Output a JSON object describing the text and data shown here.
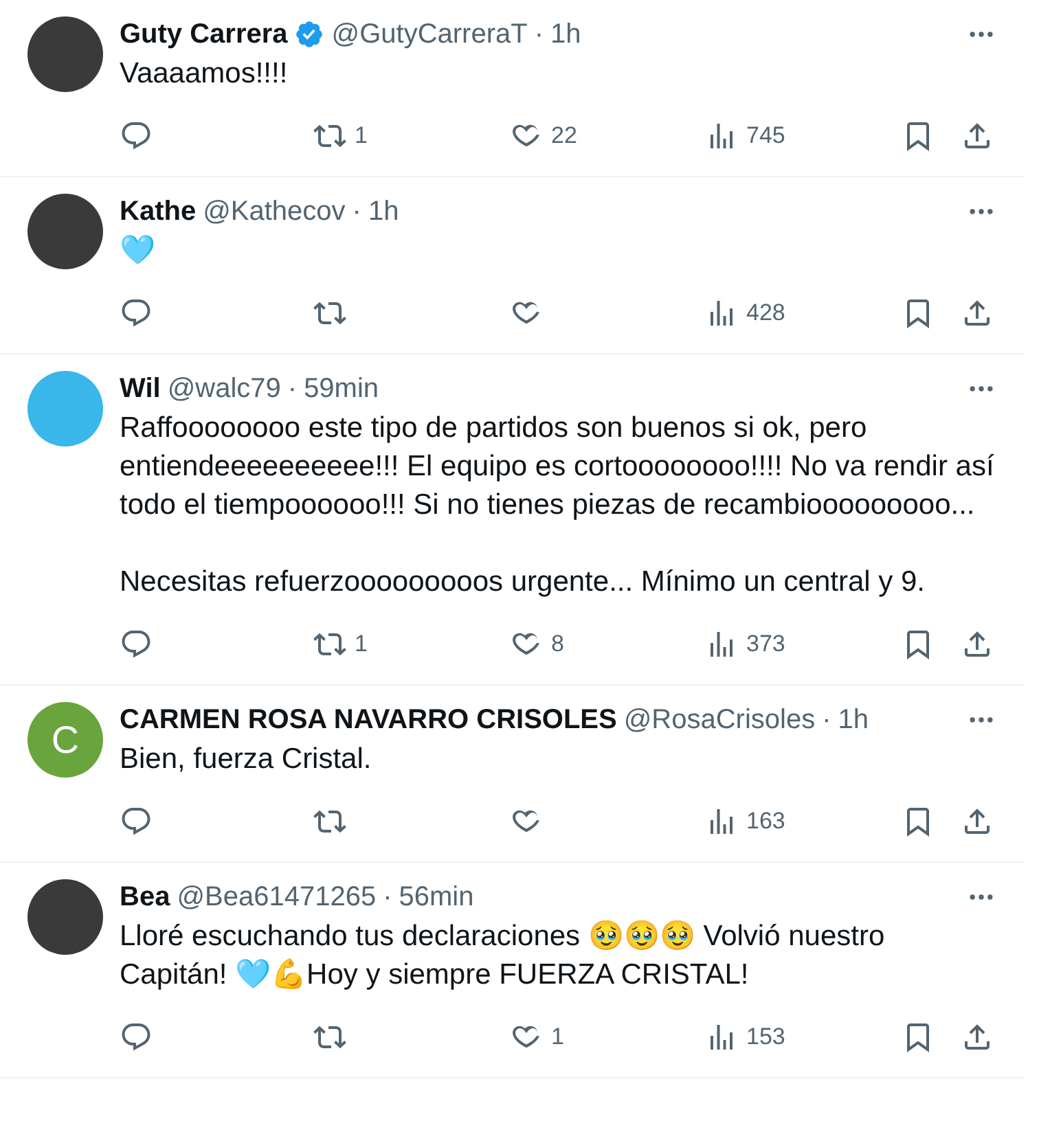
{
  "tweets": [
    {
      "avatar": {
        "kind": "photo"
      },
      "name": "Guty Carrera",
      "verified": true,
      "handle": "@GutyCarreraT",
      "separator": "·",
      "time": "1h",
      "text": [
        "Vaaaamos!!!!"
      ],
      "stats": {
        "retweets": "1",
        "likes": "22",
        "views": "745"
      }
    },
    {
      "avatar": {
        "kind": "photo"
      },
      "name": "Kathe",
      "verified": false,
      "handle": "@Kathecov",
      "separator": "·",
      "time": "1h",
      "text": [
        "🩵"
      ],
      "stats": {
        "views": "428"
      }
    },
    {
      "avatar": {
        "kind": "logo"
      },
      "name": "Wil",
      "verified": false,
      "handle": "@walc79",
      "separator": "·",
      "time": "59min",
      "text": [
        "Raffoooooooo este tipo de partidos son buenos si ok, pero entiendeeeeeeeeee!!! El equipo es cortoooooooo!!!! No va rendir así todo el tiempoooooo!!! Si no tienes piezas de recambiooooooooo...",
        "Necesitas refuerzooooooooos urgente... Mínimo un central y 9."
      ],
      "stats": {
        "retweets": "1",
        "likes": "8",
        "views": "373"
      }
    },
    {
      "avatar": {
        "kind": "letter",
        "letter": "C",
        "color": "#6aa43c"
      },
      "name": "CARMEN ROSA NAVARRO CRISOLES",
      "verified": false,
      "handle": "@RosaCrisoles",
      "separator": "·",
      "time": "1h",
      "text": [
        "Bien, fuerza Cristal."
      ],
      "stats": {
        "views": "163"
      }
    },
    {
      "avatar": {
        "kind": "photo"
      },
      "name": "Bea",
      "verified": false,
      "handle": "@Bea61471265",
      "separator": "·",
      "time": "56min",
      "text": [
        "Lloré escuchando tus declaraciones 🥹🥹🥹 Volvió nuestro Capitán! 🩵💪Hoy y siempre FUERZA CRISTAL!"
      ],
      "stats": {
        "likes": "1",
        "views": "153"
      }
    }
  ]
}
